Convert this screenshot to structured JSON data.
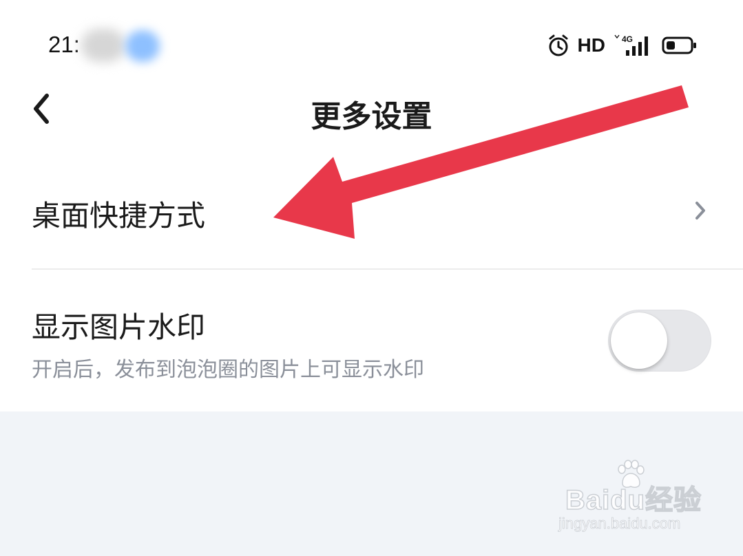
{
  "status_bar": {
    "time": "21:",
    "network_label": "HD",
    "signal_label": "4G",
    "icons": [
      "alarm-clock-icon",
      "signal-bars-icon",
      "battery-icon"
    ]
  },
  "header": {
    "title": "更多设置",
    "back_icon": "chevron-left-icon"
  },
  "settings": {
    "shortcut": {
      "label": "桌面快捷方式",
      "icon": "chevron-right-icon"
    },
    "watermark": {
      "label": "显示图片水印",
      "description": "开启后，发布到泡泡圈的图片上可显示水印",
      "enabled": false
    }
  },
  "annotation": {
    "color": "#e8384a",
    "icon": "red-arrow"
  },
  "watermark_logo": {
    "line1": "Baidu经验",
    "line2": "jingyan.baidu.com"
  },
  "colors": {
    "background": "#f1f4f8",
    "panel": "#ffffff",
    "text_primary": "#1a1a1a",
    "text_secondary": "#8a8f99",
    "toggle_off": "#e6e7ea"
  }
}
